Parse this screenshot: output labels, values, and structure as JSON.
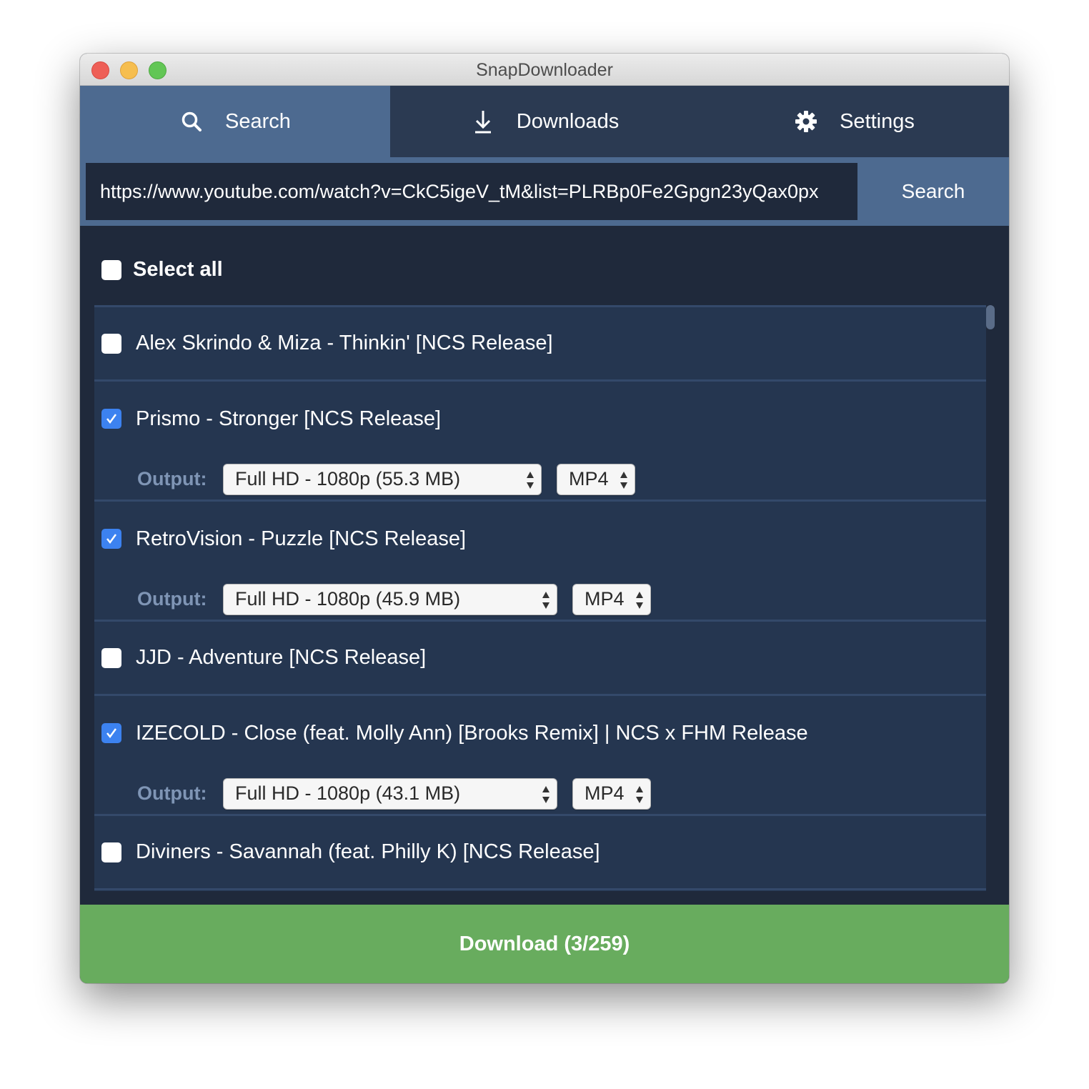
{
  "window": {
    "title": "SnapDownloader"
  },
  "tabs": [
    {
      "label": "Search",
      "icon": "search-icon",
      "active": true
    },
    {
      "label": "Downloads",
      "icon": "download-icon",
      "active": false
    },
    {
      "label": "Settings",
      "icon": "gear-icon",
      "active": false
    }
  ],
  "search": {
    "url_value": "https://www.youtube.com/watch?v=CkC5igeV_tM&list=PLRBp0Fe2Gpgn23yQax0px",
    "button_label": "Search"
  },
  "select_all": {
    "label": "Select all",
    "checked": false
  },
  "output_label": "Output:",
  "items": [
    {
      "title": "Alex Skrindo & Miza - Thinkin' [NCS Release]",
      "checked": false
    },
    {
      "title": "Prismo - Stronger [NCS Release]",
      "checked": true,
      "quality": "Full HD - 1080p (55.3 MB)",
      "format": "MP4"
    },
    {
      "title": "RetroVision - Puzzle [NCS Release]",
      "checked": true,
      "quality": "Full HD - 1080p (45.9 MB)",
      "format": "MP4"
    },
    {
      "title": "JJD - Adventure [NCS Release]",
      "checked": false
    },
    {
      "title": "IZECOLD - Close (feat. Molly Ann) [Brooks Remix] | NCS x FHM Release",
      "checked": true,
      "quality": "Full HD - 1080p (43.1 MB)",
      "format": "MP4"
    },
    {
      "title": "Diviners - Savannah (feat. Philly K) [NCS Release]",
      "checked": false
    }
  ],
  "download_button": {
    "label": "Download (3/259)",
    "selected": 3,
    "total": 259
  },
  "colors": {
    "active_tab": "#4d6a90",
    "tab_bar": "#2b3a52",
    "background": "#1f293b",
    "list_item": "#253650",
    "checkbox_checked": "#3c82f0",
    "download_button": "#68ac5e"
  }
}
